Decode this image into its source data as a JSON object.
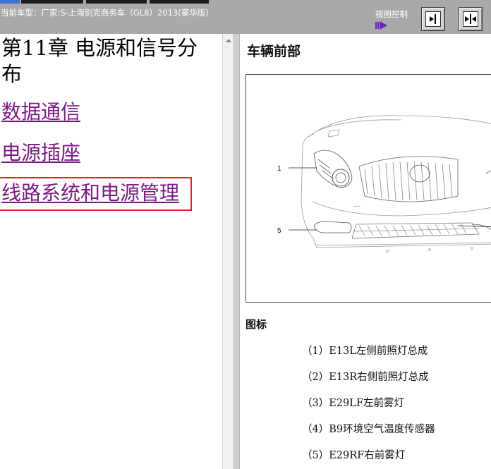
{
  "header": {
    "vehicle_label": "当前车型：厂家:S-上海别克商务车（GL8）2013(豪华版)",
    "view_control_label": "视图控制",
    "background_color": "#a9a9a9"
  },
  "left_pane": {
    "chapter_title": "第11章 电源和信号分布",
    "links": [
      {
        "label": "数据通信"
      },
      {
        "label": "电源插座"
      },
      {
        "label": "线路系统和电源管理"
      }
    ],
    "selected_link_index": 2,
    "link_color": "#7b1b84",
    "selection_color": "#e0232b"
  },
  "right_pane": {
    "section_heading": "车辆前部",
    "callouts": [
      "1",
      "5"
    ],
    "legend_title": "图标",
    "legend_items": [
      "（1）E13L左侧前照灯总成",
      "（2）E13R右侧前照灯总成",
      "（3）E29LF左前雾灯",
      "（4）B9环境空气温度传感器",
      "（5）E29RF右前雾灯"
    ]
  }
}
